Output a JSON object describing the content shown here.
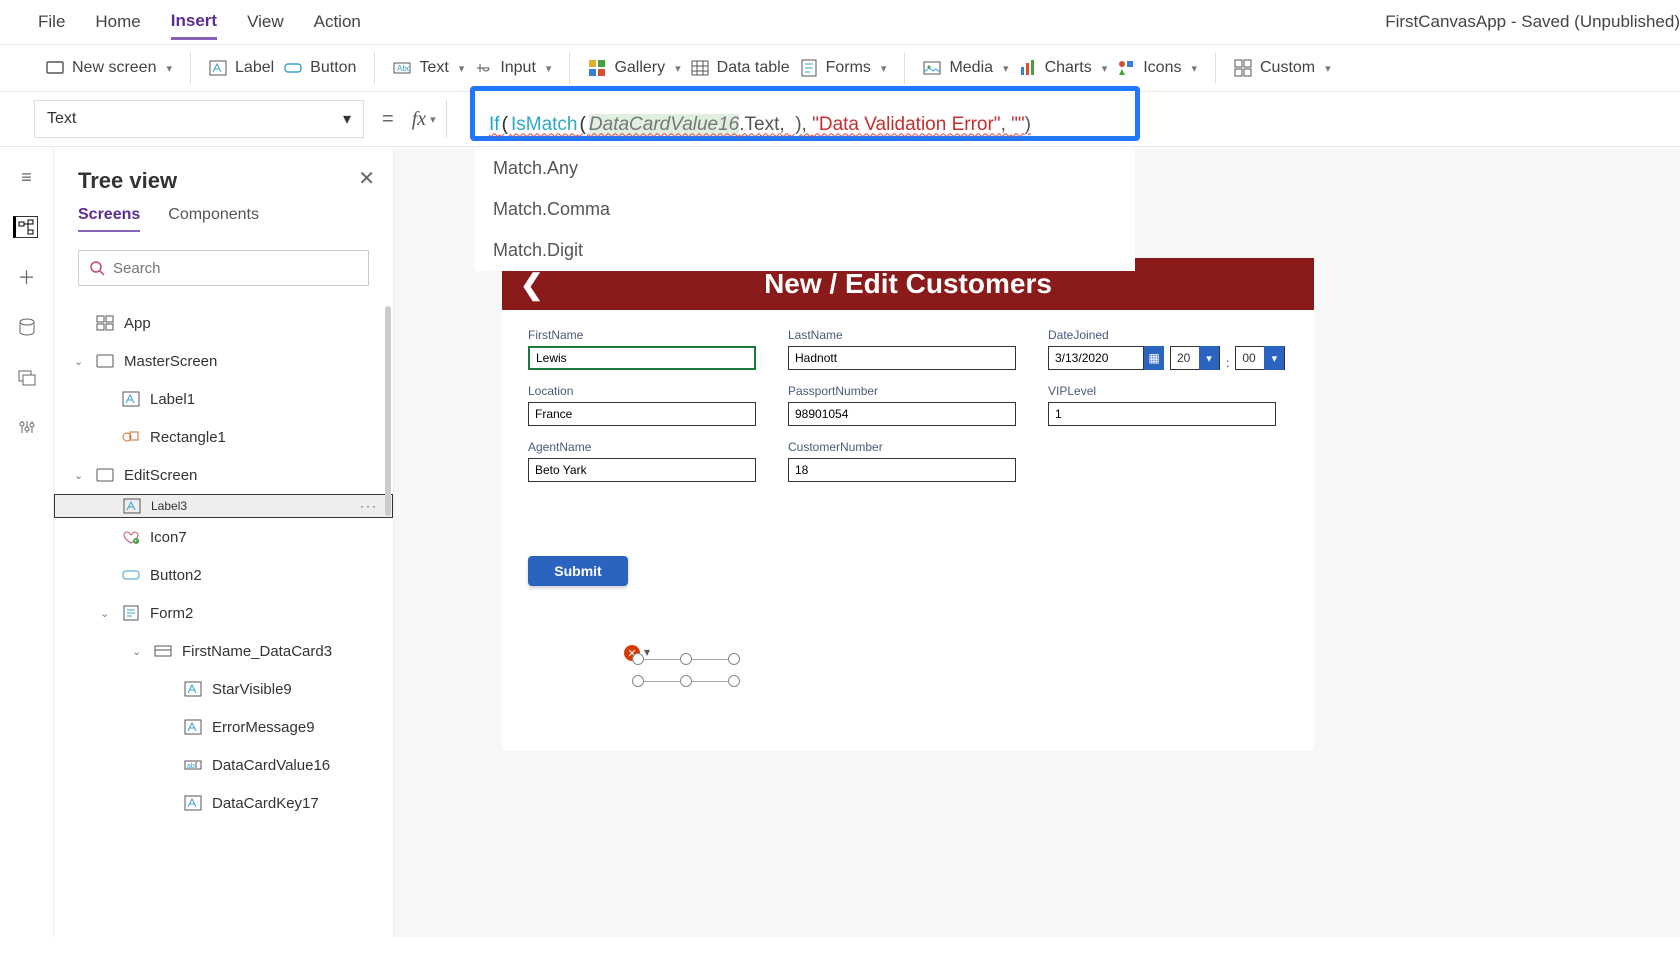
{
  "app_title": "FirstCanvasApp - Saved (Unpublished)",
  "menubar": [
    "File",
    "Home",
    "Insert",
    "View",
    "Action"
  ],
  "menubar_active_index": 2,
  "ribbon": {
    "new_screen": "New screen",
    "label": "Label",
    "button": "Button",
    "text": "Text",
    "input": "Input",
    "gallery": "Gallery",
    "data_table": "Data table",
    "forms": "Forms",
    "media": "Media",
    "charts": "Charts",
    "icons": "Icons",
    "custom": "Custom"
  },
  "property": "Text",
  "formula": {
    "if": "If",
    "ismatch": "IsMatch",
    "arg1": "DataCardValue16",
    "arg1b": ".Text, ",
    "cursor": " )",
    "comma": ", ",
    "str1": "\"Data Validation Error\"",
    "comma2": ", ",
    "str2": "\"\"",
    "close": ")"
  },
  "intellisense": [
    "Match.Any",
    "Match.Comma",
    "Match.Digit"
  ],
  "tree": {
    "title": "Tree view",
    "tabs": [
      "Screens",
      "Components"
    ],
    "search_placeholder": "Search",
    "items": [
      {
        "depth": 1,
        "label": "App",
        "icon": "app",
        "chev": ""
      },
      {
        "depth": 1,
        "label": "MasterScreen",
        "icon": "screen",
        "chev": "v"
      },
      {
        "depth": 2,
        "label": "Label1",
        "icon": "label",
        "chev": ""
      },
      {
        "depth": 2,
        "label": "Rectangle1",
        "icon": "rect",
        "chev": ""
      },
      {
        "depth": 1,
        "label": "EditScreen",
        "icon": "screen",
        "chev": "v"
      },
      {
        "depth": 2,
        "label": "Label3",
        "icon": "label",
        "chev": "",
        "sel": true,
        "dots": true
      },
      {
        "depth": 2,
        "label": "Icon7",
        "icon": "icon7",
        "chev": ""
      },
      {
        "depth": 2,
        "label": "Button2",
        "icon": "button",
        "chev": ""
      },
      {
        "depth": 2,
        "label": "Form2",
        "icon": "form",
        "chev": "v"
      },
      {
        "depth": 3,
        "label": "FirstName_DataCard3",
        "icon": "card",
        "chev": "v"
      },
      {
        "depth": 4,
        "label": "StarVisible9",
        "icon": "label",
        "chev": ""
      },
      {
        "depth": 4,
        "label": "ErrorMessage9",
        "icon": "label",
        "chev": ""
      },
      {
        "depth": 4,
        "label": "DataCardValue16",
        "icon": "input",
        "chev": ""
      },
      {
        "depth": 4,
        "label": "DataCardKey17",
        "icon": "label",
        "chev": ""
      }
    ]
  },
  "canvas": {
    "header": "New / Edit Customers",
    "fields": {
      "FirstName": {
        "label": "FirstName",
        "value": "Lewis"
      },
      "LastName": {
        "label": "LastName",
        "value": "Hadnott"
      },
      "DateJoined": {
        "label": "DateJoined",
        "date": "3/13/2020",
        "h": "20",
        "m": "00"
      },
      "Location": {
        "label": "Location",
        "value": "France"
      },
      "PassportNumber": {
        "label": "PassportNumber",
        "value": "98901054"
      },
      "VIPLevel": {
        "label": "VIPLevel",
        "value": "1"
      },
      "AgentName": {
        "label": "AgentName",
        "value": "Beto Yark"
      },
      "CustomerNumber": {
        "label": "CustomerNumber",
        "value": "18"
      }
    },
    "submit": "Submit"
  }
}
